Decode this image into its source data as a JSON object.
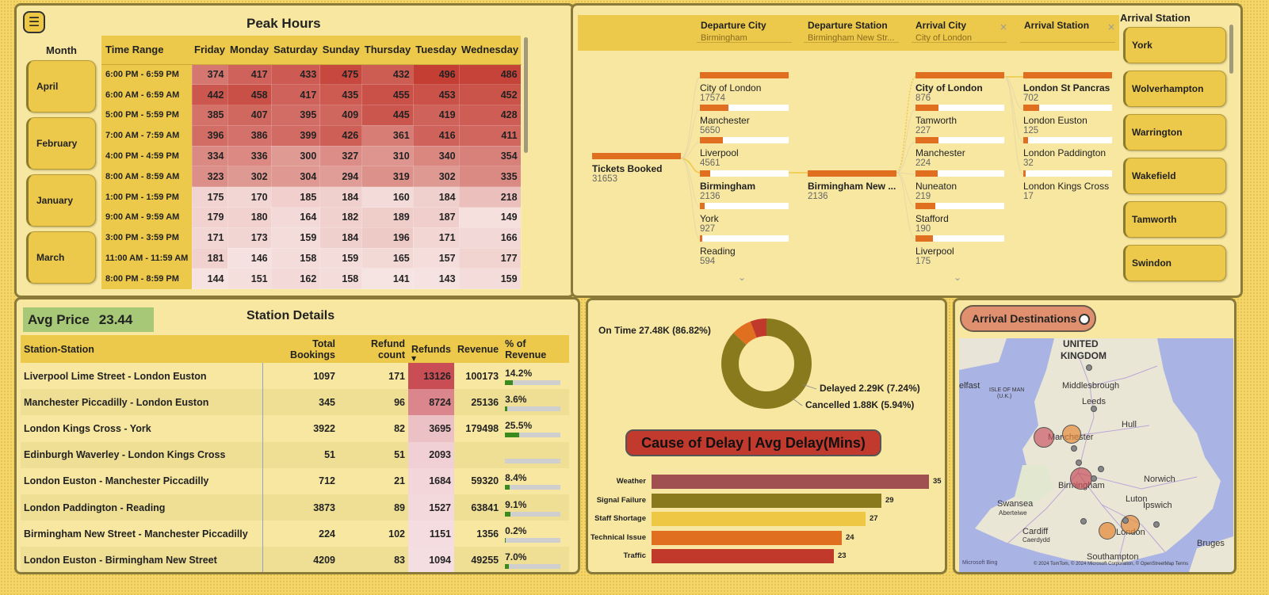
{
  "peak": {
    "title": "Peak Hours",
    "menu_icon": "☰",
    "month_title": "Month",
    "months": [
      "April",
      "February",
      "January",
      "March"
    ],
    "time_header": "Time Range",
    "days": [
      "Friday",
      "Monday",
      "Saturday",
      "Sunday",
      "Thursday",
      "Tuesday",
      "Wednesday"
    ],
    "rows": [
      {
        "time": "6:00 PM - 6:59 PM",
        "v": [
          374,
          417,
          433,
          475,
          432,
          496,
          486
        ]
      },
      {
        "time": "6:00 AM - 6:59 AM",
        "v": [
          442,
          458,
          417,
          435,
          455,
          453,
          452
        ]
      },
      {
        "time": "5:00 PM - 5:59 PM",
        "v": [
          385,
          407,
          395,
          409,
          445,
          419,
          428
        ]
      },
      {
        "time": "7:00 AM - 7:59 AM",
        "v": [
          396,
          386,
          399,
          426,
          361,
          416,
          411
        ]
      },
      {
        "time": "4:00 PM - 4:59 PM",
        "v": [
          334,
          336,
          300,
          327,
          310,
          340,
          354
        ]
      },
      {
        "time": "8:00 AM - 8:59 AM",
        "v": [
          323,
          302,
          304,
          294,
          319,
          302,
          335
        ]
      },
      {
        "time": "1:00 PM - 1:59 PM",
        "v": [
          175,
          170,
          185,
          184,
          160,
          184,
          218
        ]
      },
      {
        "time": "9:00 AM - 9:59 AM",
        "v": [
          179,
          180,
          164,
          182,
          189,
          187,
          149
        ]
      },
      {
        "time": "3:00 PM - 3:59 PM",
        "v": [
          171,
          173,
          159,
          184,
          196,
          171,
          166
        ]
      },
      {
        "time": "11:00 AM - 11:59 AM",
        "v": [
          181,
          146,
          158,
          159,
          165,
          157,
          177
        ]
      },
      {
        "time": "8:00 PM - 8:59 PM",
        "v": [
          144,
          151,
          162,
          158,
          141,
          143,
          159
        ]
      }
    ]
  },
  "tree": {
    "headers": [
      {
        "title": "Departure City",
        "value": "Birmingham"
      },
      {
        "title": "Departure Station",
        "value": "Birmingham New Str..."
      },
      {
        "title": "Arrival City",
        "value": "City of London"
      },
      {
        "title": "Arrival Station",
        "value": ""
      }
    ],
    "close_icon": "×",
    "root": {
      "label": "Tickets Booked",
      "value": "31653"
    },
    "level1": [
      {
        "label": "City of London",
        "value": "17574",
        "frac": 1.0
      },
      {
        "label": "Manchester",
        "value": "5650",
        "frac": 0.32
      },
      {
        "label": "Liverpool",
        "value": "4561",
        "frac": 0.26
      },
      {
        "label": "Birmingham",
        "value": "2136",
        "frac": 0.12,
        "selected": true
      },
      {
        "label": "York",
        "value": "927",
        "frac": 0.05
      },
      {
        "label": "Reading",
        "value": "594",
        "frac": 0.03
      }
    ],
    "level2": [
      {
        "label": "Birmingham New ...",
        "value": "2136",
        "frac": 1.0,
        "selected": true
      }
    ],
    "level3": [
      {
        "label": "City of London",
        "value": "876",
        "frac": 1.0,
        "selected": true
      },
      {
        "label": "Tamworth",
        "value": "227",
        "frac": 0.26
      },
      {
        "label": "Manchester",
        "value": "224",
        "frac": 0.26
      },
      {
        "label": "Nuneaton",
        "value": "219",
        "frac": 0.25
      },
      {
        "label": "Stafford",
        "value": "190",
        "frac": 0.22
      },
      {
        "label": "Liverpool",
        "value": "175",
        "frac": 0.2
      }
    ],
    "level4": [
      {
        "label": "London St Pancras",
        "value": "702",
        "frac": 1.0,
        "bold": true
      },
      {
        "label": "London Euston",
        "value": "125",
        "frac": 0.18
      },
      {
        "label": "London Paddington",
        "value": "32",
        "frac": 0.05
      },
      {
        "label": "London Kings Cross",
        "value": "17",
        "frac": 0.02
      }
    ],
    "chevron_icon": "⌄",
    "arrival_title": "Arrival Station",
    "arrival_stations": [
      "York",
      "Wolverhampton",
      "Warrington",
      "Wakefield",
      "Tamworth",
      "Swindon"
    ]
  },
  "station": {
    "avg_label": "Avg Price",
    "avg_value": "23.44",
    "title": "Station Details",
    "columns": [
      "Station-Station",
      "Total Bookings",
      "Refund count",
      "Refunds",
      "Revenue",
      "% of Revenue"
    ],
    "sort_icon": "▼",
    "rows": [
      {
        "name": "Liverpool Lime Street - London Euston",
        "bookings": "1097",
        "refund_count": "171",
        "refunds": "13126",
        "revenue": "100173",
        "pct": "14.2%",
        "pct_val": 14.2,
        "heat": 1.0
      },
      {
        "name": "Manchester Piccadilly - London Euston",
        "bookings": "345",
        "refund_count": "96",
        "refunds": "8724",
        "revenue": "25136",
        "pct": "3.6%",
        "pct_val": 3.6,
        "heat": 0.62
      },
      {
        "name": "London Kings Cross - York",
        "bookings": "3922",
        "refund_count": "82",
        "refunds": "3695",
        "revenue": "179498",
        "pct": "25.5%",
        "pct_val": 25.5,
        "heat": 0.22
      },
      {
        "name": "Edinburgh Waverley - London Kings Cross",
        "bookings": "51",
        "refund_count": "51",
        "refunds": "2093",
        "revenue": "",
        "pct": "",
        "pct_val": 0,
        "heat": 0.12
      },
      {
        "name": "London Euston - Manchester Piccadilly",
        "bookings": "712",
        "refund_count": "21",
        "refunds": "1684",
        "revenue": "59320",
        "pct": "8.4%",
        "pct_val": 8.4,
        "heat": 0.08
      },
      {
        "name": "London Paddington - Reading",
        "bookings": "3873",
        "refund_count": "89",
        "refunds": "1527",
        "revenue": "63841",
        "pct": "9.1%",
        "pct_val": 9.1,
        "heat": 0.07
      },
      {
        "name": "Birmingham New Street - Manchester Piccadilly",
        "bookings": "224",
        "refund_count": "102",
        "refunds": "1151",
        "revenue": "1356",
        "pct": "0.2%",
        "pct_val": 0.2,
        "heat": 0.04
      },
      {
        "name": "London Euston - Birmingham New Street",
        "bookings": "4209",
        "refund_count": "83",
        "refunds": "1094",
        "revenue": "49255",
        "pct": "7.0%",
        "pct_val": 7.0,
        "heat": 0.03
      }
    ]
  },
  "status": {
    "donut": [
      {
        "label": "On Time 27.48K (86.82%)",
        "value": 86.82,
        "color": "#8a7a1e"
      },
      {
        "label": "Delayed 2.29K (7.24%)",
        "value": 7.24,
        "color": "#e07020"
      },
      {
        "label": "Cancelled 1.88K (5.94%)",
        "value": 5.94,
        "color": "#c0392b"
      }
    ],
    "delay_title": "Cause of Delay | Avg Delay(Mins)",
    "delays": [
      {
        "label": "Weather",
        "value": 35,
        "color": "#a05050"
      },
      {
        "label": "Signal Failure",
        "value": 29,
        "color": "#8a7a1e"
      },
      {
        "label": "Staff Shortage",
        "value": 27,
        "color": "#eec845"
      },
      {
        "label": "Technical Issue",
        "value": 24,
        "color": "#e07020"
      },
      {
        "label": "Traffic",
        "value": 23,
        "color": "#c0392b"
      }
    ]
  },
  "map": {
    "button_label": "Arrival Destinations",
    "cities": [
      "UNITED",
      "KINGDOM",
      "Middlesbrough",
      "Leeds",
      "Hull",
      "Manchester",
      "Birmingham",
      "Norwich",
      "Luton",
      "Ipswich",
      "Swansea",
      "Aberteiwe",
      "Cardiff",
      "Caerdydd",
      "London",
      "Southampton",
      "Bruges",
      "ISLE OF MAN",
      "(U.K.)",
      "elfast"
    ],
    "attribution": "© 2024 TomTom, © 2024 Microsoft Corporation, © OpenStreetMap  Terms",
    "logo": "Microsoft Bing"
  }
}
